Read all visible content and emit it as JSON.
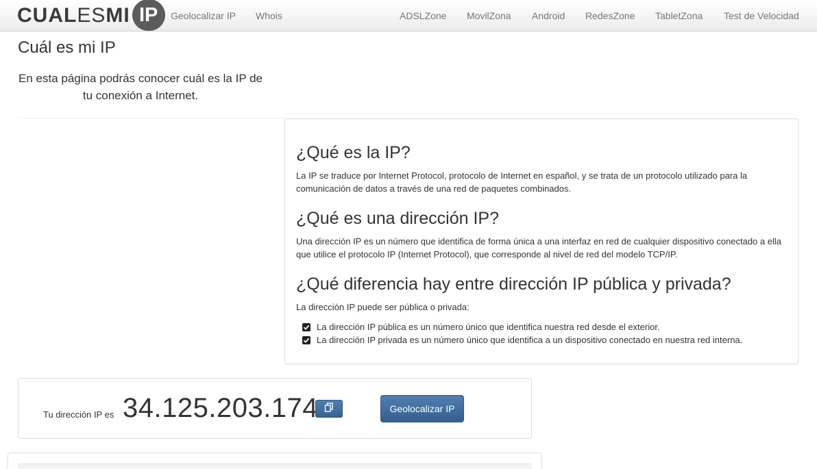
{
  "brand": {
    "logo_bold_1": "CUAL",
    "logo_light": "ES",
    "logo_bold_2": "MI",
    "logo_badge": "IP"
  },
  "nav": {
    "left": [
      "Geolocalizar IP",
      "Whois"
    ],
    "right": [
      "ADSLZone",
      "MovilZona",
      "Android",
      "RedesZone",
      "TabletZona",
      "Test de Velocidad"
    ]
  },
  "page": {
    "title": "Cuál es mi IP",
    "intro": "En esta página podrás conocer cuál es la IP de tu conexión a Internet."
  },
  "info": {
    "sections": [
      {
        "heading": "¿Qué es la IP?",
        "text": "La IP se traduce por Internet Protocol, protocolo de Internet en español, y se trata de un protocolo utilizado para la comunicación de datos a través de una red de paquetes combinados."
      },
      {
        "heading": "¿Qué es una dirección IP?",
        "text": "Una dirección IP es un número que identifica de forma única a una interfaz en red de cualquier dispositivo conectado a ella que utilice el protocolo IP (Internet Protocol), que corresponde al nivel de red del modelo TCP/IP."
      },
      {
        "heading": "¿Qué diferencia hay entre dirección IP pública y privada?",
        "text": "La dirección IP puede ser pública o privada:"
      }
    ],
    "checklist": [
      "La dirección IP pública es un número único que identifica nuestra red desde el exterior.",
      "La dirección IP privada es un número único que identifica a un dispositivo conectado en nuestra red interna."
    ]
  },
  "ip": {
    "label": "Tu dirección IP es",
    "value": "34.125.203.174",
    "copy_icon": "copy-icon",
    "geolocate_label": "Geolocalizar IP"
  },
  "colors": {
    "button_blue": "#3b6896",
    "logo_gray": "#5b5b5b"
  }
}
